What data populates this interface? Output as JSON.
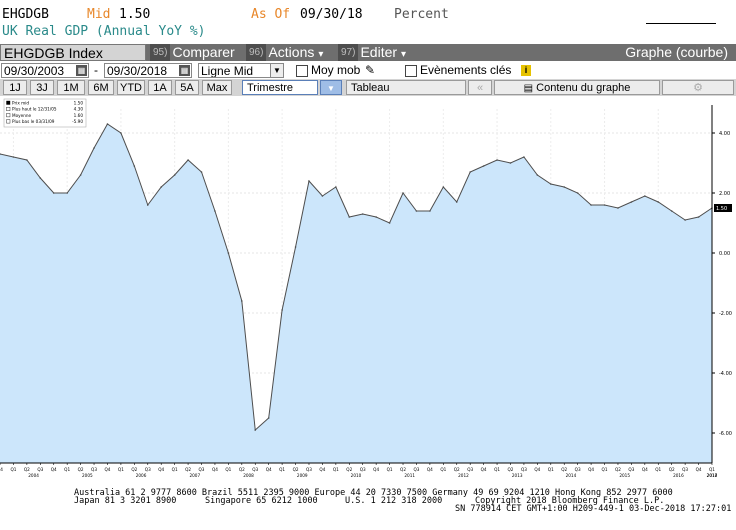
{
  "header": {
    "ticker": "EHGDGB",
    "price_field": "Mid",
    "price_value": "1.50",
    "as_of_label": "As Of",
    "as_of_date": "09/30/18",
    "unit": "Percent",
    "description": "UK Real GDP (Annual YoY %)",
    "colors": {
      "ticker": "#000000",
      "field": "#e8872a",
      "description": "#2a8a8a"
    }
  },
  "toolbar": {
    "security": "EHGDGB Index",
    "compare_num": "95)",
    "compare_label": "Comparer",
    "actions_num": "96)",
    "actions_label": "Actions",
    "edit_num": "97)",
    "edit_label": "Editer",
    "graph_type": "Graphe (courbe)"
  },
  "controls": {
    "start_date": "09/30/2003",
    "date_sep": "-",
    "end_date": "09/30/2018",
    "line_type": "Ligne Mid",
    "moving_avg_label": "Moy mob",
    "events_label": "Evènements clés",
    "info_icon_text": "i"
  },
  "range_buttons": [
    "1J",
    "3J",
    "1M",
    "6M",
    "YTD",
    "1A",
    "5A",
    "Max"
  ],
  "period": {
    "label": "Trimestre",
    "table_label": "Tableau",
    "content_label": "Contenu du graphe"
  },
  "legend": {
    "rows": [
      {
        "label": "Prix mid",
        "value": "1.50"
      },
      {
        "label": "Plus haut le 12/31/05",
        "value": "4.30"
      },
      {
        "label": "Moyenne",
        "value": "1.60"
      },
      {
        "label": "Plus bas le 03/31/09",
        "value": "-5.90"
      }
    ]
  },
  "chart_data": {
    "type": "area",
    "x": [
      "2003 Q4",
      "2004 Q1",
      "2004 Q2",
      "2004 Q3",
      "2004 Q4",
      "2005 Q1",
      "2005 Q2",
      "2005 Q3",
      "2005 Q4",
      "2006 Q1",
      "2006 Q2",
      "2006 Q3",
      "2006 Q4",
      "2007 Q1",
      "2007 Q2",
      "2007 Q3",
      "2007 Q4",
      "2008 Q1",
      "2008 Q2",
      "2008 Q3",
      "2008 Q4",
      "2009 Q1",
      "2009 Q2",
      "2009 Q3",
      "2009 Q4",
      "2010 Q1",
      "2010 Q2",
      "2010 Q3",
      "2010 Q4",
      "2011 Q1",
      "2011 Q2",
      "2011 Q3",
      "2011 Q4",
      "2012 Q1",
      "2012 Q2",
      "2012 Q3",
      "2012 Q4",
      "2013 Q1",
      "2013 Q2",
      "2013 Q3",
      "2013 Q4",
      "2014 Q1",
      "2014 Q2",
      "2014 Q3",
      "2014 Q4",
      "2015 Q1",
      "2015 Q2",
      "2015 Q3",
      "2015 Q4",
      "2016 Q1",
      "2016 Q2",
      "2016 Q3",
      "2016 Q4",
      "2017 Q1",
      "2017 Q2",
      "2017 Q3",
      "2017 Q4",
      "2018 Q1",
      "2018 Q2",
      "2018 Q3"
    ],
    "values": [
      3.3,
      3.2,
      3.1,
      2.5,
      2.0,
      2.0,
      2.6,
      3.5,
      4.3,
      4.0,
      2.9,
      1.6,
      2.2,
      2.6,
      3.1,
      2.7,
      1.4,
      0.0,
      -1.6,
      -5.9,
      -5.5,
      -1.9,
      0.2,
      2.4,
      1.9,
      2.2,
      1.2,
      1.3,
      1.2,
      1.0,
      2.0,
      1.4,
      1.4,
      2.2,
      1.7,
      2.7,
      2.9,
      3.1,
      3.0,
      3.2,
      2.6,
      2.3,
      2.2,
      2.0,
      1.6,
      1.6,
      1.5,
      1.7,
      1.9,
      1.7,
      1.4,
      1.1,
      1.2,
      1.5
    ],
    "ylim": [
      -7.0,
      4.8
    ],
    "y_ticks": [
      4.0,
      2.0,
      0.0,
      -2.0,
      -4.0,
      -6.0
    ],
    "y_tick_labels": [
      "4.00",
      "2.00",
      "0.00",
      "-2.00",
      "-4.00",
      "-6.00"
    ],
    "last_value_label": "1.50",
    "quarter_labels": [
      "Q4",
      "Q1",
      "Q2",
      "Q3"
    ],
    "year_labels": [
      "2004",
      "2005",
      "2006",
      "2007",
      "2008",
      "2009",
      "2010",
      "2011",
      "2012",
      "2013",
      "2014",
      "2015",
      "2016",
      "2017",
      "2018"
    ],
    "fill_color": "#cce6fb",
    "line_color": "#4d4d4d",
    "legend_position": "top-left",
    "grid": true
  },
  "footer": {
    "line1": "Australia 61 2 9777 8600 Brazil 5511 2395 9000 Europe 44 20 7330 7500 Germany 49 69 9204 1210 Hong Kong 852 2977 6000",
    "line2a": "Japan 81 3 3201 8900",
    "line2b": "Singapore 65 6212 1000",
    "line2c": "U.S. 1 212 318 2000",
    "line2d": "Copyright 2018 Bloomberg Finance L.P.",
    "line3": "SN 778914 CET  GMT+1:00 H209-449-1 03-Dec-2018 17:27:01"
  }
}
